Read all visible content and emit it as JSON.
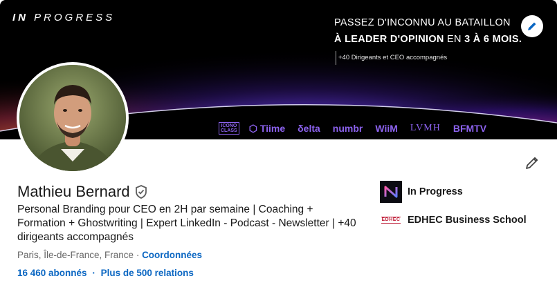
{
  "banner": {
    "brand_prefix": "IN",
    "brand_suffix": " PROGRESS",
    "headline_line1": "PASSEZ D'INCONNU AU BATAILLON",
    "headline_line2_bold1": "À LEADER D'OPINION",
    "headline_line2_mid": " EN ",
    "headline_line2_bold2": "3 À 6 MOIS.",
    "headline_line3": "+40 Dirigeants et CEO accompagnés",
    "client_logos": {
      "icono_line1": "ICONO",
      "icono_line2": "CLASS",
      "tiime": "⬡ Tiime",
      "delta": "δelta",
      "numbr": "numbr",
      "wiim": "WiiM",
      "lvmh": "LVMH",
      "bfmtv": "BFMTV"
    },
    "accent_color": "#8c62ee"
  },
  "profile": {
    "name": "Mathieu Bernard",
    "tagline": "Personal Branding pour CEO en 2H par semaine | Coaching + Formation + Ghostwriting | Expert LinkedIn - Podcast - Newsletter | +40 dirigeants accompagnés",
    "location": "Paris, Île-de-France, France",
    "location_separator": " · ",
    "contact_link": "Coordonnées",
    "followers": "16 460 abonnés",
    "stats_separator": "·",
    "connections": "Plus de 500 relations"
  },
  "organizations": [
    {
      "name": "In Progress"
    },
    {
      "name": "EDHEC Business School",
      "logo_text": "EDHEC"
    }
  ],
  "colors": {
    "link": "#0a66c2",
    "text": "#191919",
    "muted": "#666666"
  },
  "icons": {
    "banner_edit": "pencil-icon",
    "profile_edit": "pencil-icon",
    "verified": "verified-shield-icon"
  }
}
